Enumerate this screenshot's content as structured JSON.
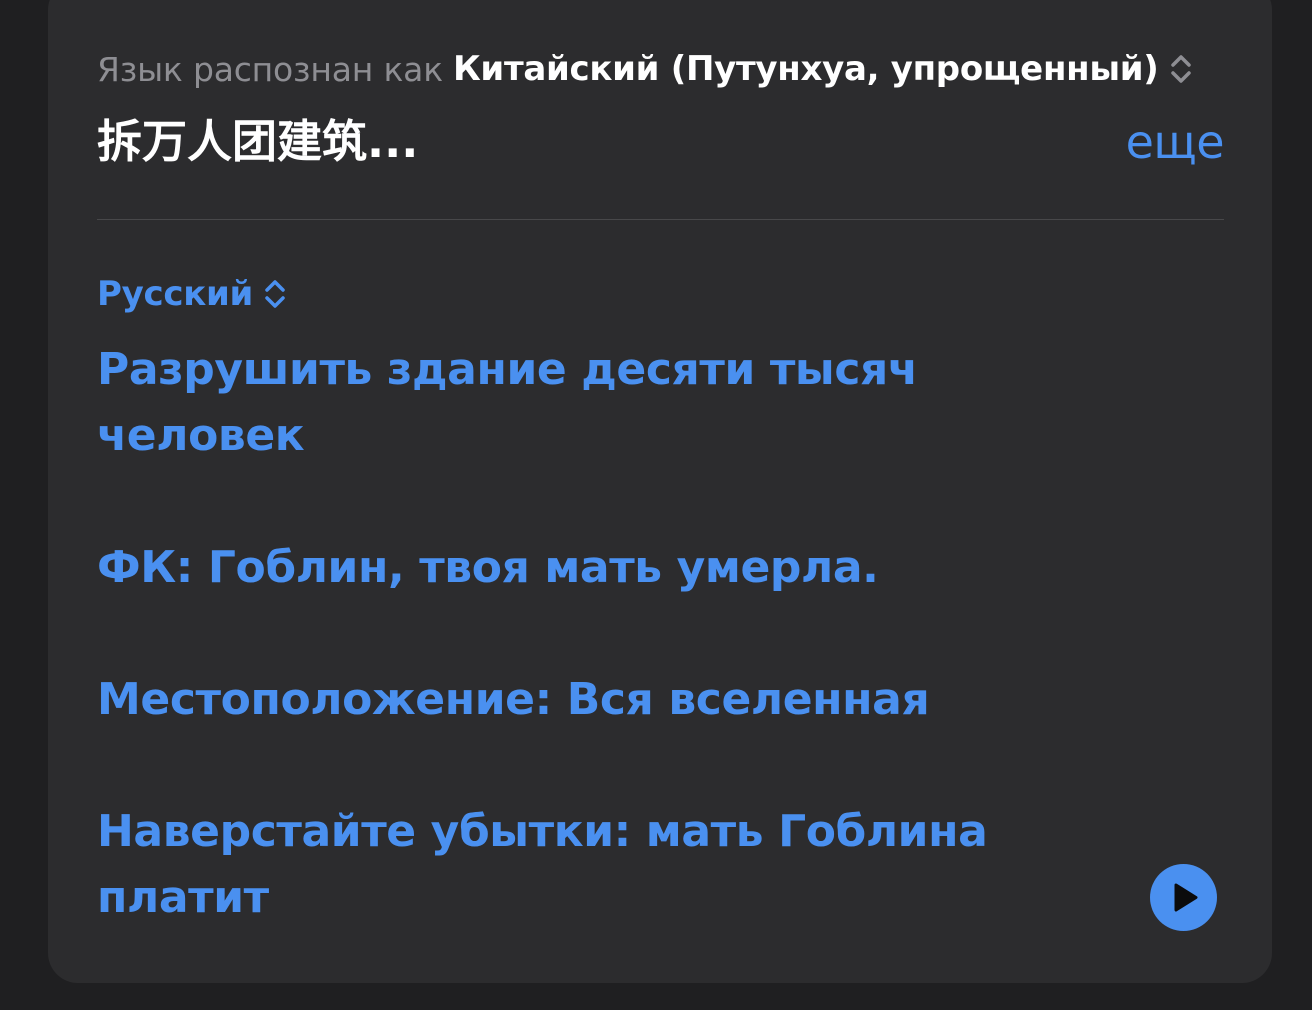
{
  "source": {
    "detected_prefix": "Язык распознан как",
    "detected_language": "Китайский (Путунхуа, упрощенный)",
    "text": "拆万人团建筑...",
    "more_label": "еще"
  },
  "target": {
    "language": "Русский",
    "lines": [
      "Разрушить здание десяти тысяч человек",
      "ФК: Гоблин, твоя мать умерла.",
      "Местоположение: Вся вселенная",
      "Наверстайте убытки: мать Гоблина платит"
    ]
  },
  "icons": {
    "source_language_chevron": "chevron-up-down-icon",
    "target_language_chevron": "chevron-up-down-icon",
    "play": "play-icon"
  },
  "colors": {
    "accent": "#4a90f0",
    "card_background": "#2c2c2e",
    "secondary_text": "#8e8e93",
    "primary_text": "#ffffff"
  }
}
